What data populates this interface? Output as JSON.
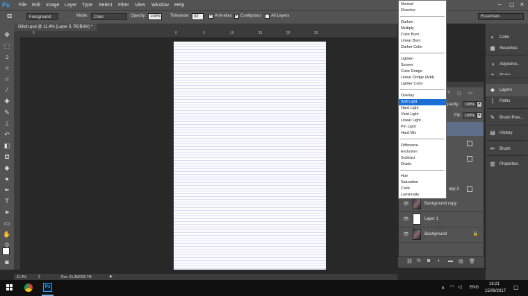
{
  "menubar": {
    "logo": "Ps",
    "items": [
      "File",
      "Edit",
      "Image",
      "Layer",
      "Type",
      "Select",
      "Filter",
      "View",
      "Window",
      "Help"
    ],
    "window_controls": [
      "–",
      "▢",
      "✕"
    ]
  },
  "options": {
    "source_value": "Foreground",
    "mode_label": "Mode:",
    "mode_value": "Color",
    "opacity_label": "Opacity:",
    "opacity_value": "100%",
    "tolerance_label": "Tolerance:",
    "tolerance_value": "32",
    "antialias_label": "Anti-alias",
    "contiguous_label": "Contiguous",
    "all_layers_label": "All Layers",
    "workspace_value": "Essentials"
  },
  "document": {
    "tab_title": "Glitch.psd @ 11.4% (Layer 3, RGB/8#) *"
  },
  "ruler": {
    "ticks": [
      "5",
      "0",
      "5",
      "10",
      "15",
      "20",
      "25"
    ]
  },
  "status": {
    "zoom": "11.4%",
    "doc_info": "Doc: 51.3M/326.7M"
  },
  "dock": {
    "items": [
      {
        "icon": "◐",
        "label": "Color"
      },
      {
        "icon": "▦",
        "label": "Swatches"
      },
      {
        "icon": "◑",
        "label": "Adjustme..."
      },
      {
        "icon": "◈",
        "label": "Styles"
      },
      {
        "icon": "◆",
        "label": "Layers"
      },
      {
        "icon": "⟆",
        "label": "Paths"
      },
      {
        "icon": "✎",
        "label": "Brush Pres..."
      },
      {
        "icon": "▤",
        "label": "History"
      },
      {
        "icon": "✏",
        "label": "Brush"
      },
      {
        "icon": "▥",
        "label": "Properties"
      }
    ]
  },
  "layers": {
    "opacity_label": "pacity:",
    "opacity_value": "100%",
    "fill_label": "Fill:",
    "fill_value": "100%",
    "partial_label": "opy 2",
    "rows": [
      {
        "name": "Background copy",
        "thumb": "photo"
      },
      {
        "name": "Layer 1",
        "thumb": "white"
      },
      {
        "name": "Background",
        "thumb": "photo",
        "locked": "🔒"
      }
    ]
  },
  "blend_modes": {
    "groups": [
      [
        "Normal",
        "Dissolve"
      ],
      [
        "Darken",
        "Multiply",
        "Color Burn",
        "Linear Burn",
        "Darker Color"
      ],
      [
        "Lighten",
        "Screen",
        "Color Dodge",
        "Linear Dodge (Add)",
        "Lighter Color"
      ],
      [
        "Overlay",
        "Soft Light",
        "Hard Light",
        "Vivid Light",
        "Linear Light",
        "Pin Light",
        "Hard Mix"
      ],
      [
        "Difference",
        "Exclusion",
        "Subtract",
        "Divide"
      ],
      [
        "Hue",
        "Saturation",
        "Color",
        "Luminosity"
      ]
    ],
    "selected": "Soft Light"
  },
  "taskbar": {
    "system_label": "ENG",
    "time": "16:21",
    "date": "15/09/2017"
  },
  "colors": {
    "accent": "#1a6fd6",
    "ps_blue": "#31a8ff"
  }
}
